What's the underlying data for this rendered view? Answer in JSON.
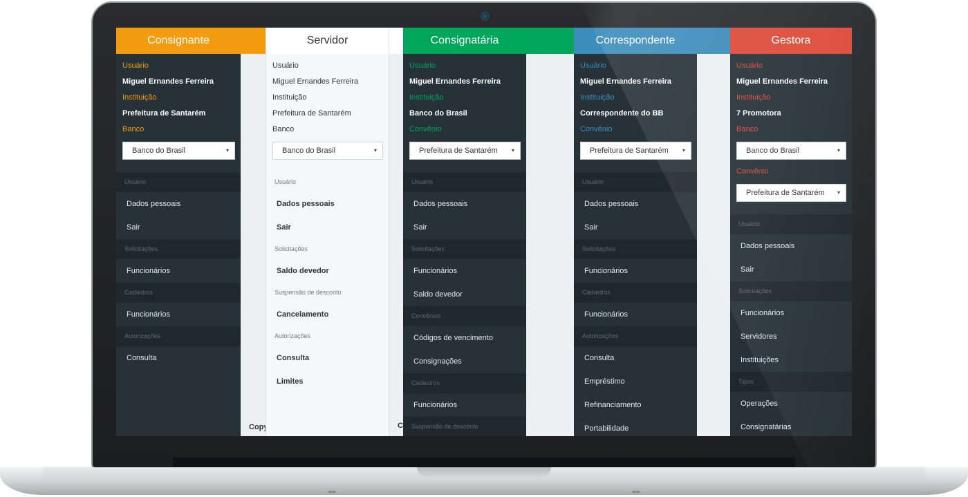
{
  "colors": {
    "consignante": "#f39c12",
    "servidor": "#ffffff",
    "consignataria": "#00a65a",
    "correspondente": "#3c8dbc",
    "gestora": "#dd4b39",
    "dark_bg": "#263238"
  },
  "icons": {
    "select_caret": "▾"
  },
  "columns": {
    "consignante": {
      "title": "Consignante",
      "fields": [
        {
          "label": "Usuário",
          "value": "Miguel Ernandes Ferreira"
        },
        {
          "label": "Instituição",
          "value": "Prefeitura de Santarém"
        }
      ],
      "selects": [
        {
          "label": "Banco",
          "value": "Banco do Brasil"
        }
      ],
      "menu": [
        {
          "section": "Usuário",
          "items": [
            "Dados pessoais",
            "Sair"
          ]
        },
        {
          "section": "Solicitações",
          "items": [
            "Funcionários"
          ]
        },
        {
          "section": "Cadastros",
          "items": [
            "Funcionários"
          ]
        },
        {
          "section": "Autorizações",
          "items": [
            "Consulta"
          ]
        }
      ]
    },
    "servidor": {
      "title": "Servidor",
      "fields": [
        {
          "label": "Usuário",
          "value": "Miguel Ernandes Ferreira"
        },
        {
          "label": "Instituição",
          "value": "Prefeitura de Santarém"
        }
      ],
      "selects": [
        {
          "label": "Banco",
          "value": "Banco do Brasil"
        }
      ],
      "menu": [
        {
          "section": "Usuário",
          "items": [
            "Dados pessoais",
            "Sair"
          ]
        },
        {
          "section": "Solicitações",
          "items": [
            "Saldo devedor"
          ]
        },
        {
          "section": "Suspensão de desconto",
          "items": [
            "Cancelamento"
          ]
        },
        {
          "section": "Autorizações",
          "items": [
            "Consulta",
            "Limites"
          ]
        }
      ],
      "copyright_left": "Copy",
      "copyright_right": "C"
    },
    "consignataria": {
      "title": "Consignatária",
      "fields": [
        {
          "label": "Usuário",
          "value": "Miguel Ernandes Ferreira"
        },
        {
          "label": "Instituição",
          "value": "Banco do Brasil"
        }
      ],
      "selects": [
        {
          "label": "Convênio",
          "value": "Prefeitura de Santarém"
        }
      ],
      "menu": [
        {
          "section": "Usuário",
          "items": [
            "Dados pessoais",
            "Sair"
          ]
        },
        {
          "section": "Solicitações",
          "items": [
            "Funcionários",
            "Saldo devedor"
          ]
        },
        {
          "section": "Convênios",
          "items": [
            "Códigos de vencimento",
            "Consignações"
          ]
        },
        {
          "section": "Cadastros",
          "items": [
            "Funcionários"
          ]
        },
        {
          "section": "Suspensão de desconto",
          "items": []
        }
      ]
    },
    "correspondente": {
      "title": "Correspondente",
      "fields": [
        {
          "label": "Usuário",
          "value": "Miguel Ernandes Ferreira"
        },
        {
          "label": "Instituição",
          "value": "Correspondente do BB"
        }
      ],
      "selects": [
        {
          "label": "Convênio",
          "value": "Prefeitura de Santarém"
        }
      ],
      "menu": [
        {
          "section": "Usuário",
          "items": [
            "Dados pessoais",
            "Sair"
          ]
        },
        {
          "section": "Solicitações",
          "items": [
            "Funcionários"
          ]
        },
        {
          "section": "Cadastros",
          "items": [
            "Funcionários"
          ]
        },
        {
          "section": "Autorizações",
          "items": [
            "Consulta",
            "Empréstimo",
            "Refinanciamento",
            "Portabilidade"
          ]
        }
      ]
    },
    "gestora": {
      "title": "Gestora",
      "fields": [
        {
          "label": "Usuário",
          "value": "Miguel Ernandes Ferreira"
        },
        {
          "label": "Instituição",
          "value": "7 Promotora"
        }
      ],
      "selects": [
        {
          "label": "Banco",
          "value": "Banco do Brasil"
        },
        {
          "label": "Convênio",
          "value": "Prefeitura de Santarém"
        }
      ],
      "menu": [
        {
          "section": "Usuário",
          "items": [
            "Dados pessoais",
            "Sair"
          ]
        },
        {
          "section": "Solicitações",
          "items": [
            "Funcionários",
            "Servidores",
            "Instituições"
          ]
        },
        {
          "section": "Tipos",
          "items": [
            "Operações",
            "Consignatárias"
          ]
        }
      ]
    }
  }
}
